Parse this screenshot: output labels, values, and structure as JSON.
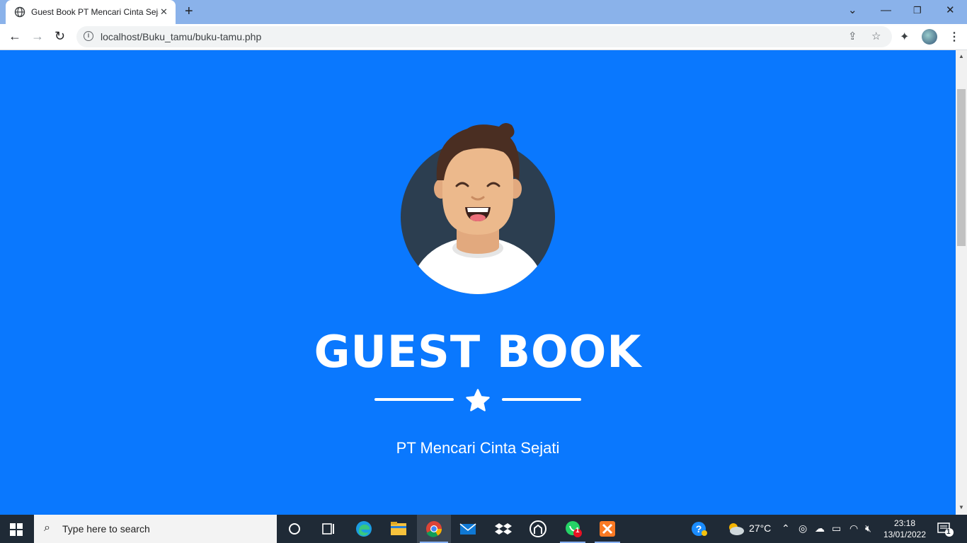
{
  "browser": {
    "tab_title": "Guest Book PT Mencari Cinta Sejati",
    "url": "localhost/Buku_tamu/buku-tamu.php"
  },
  "page": {
    "title": "GUEST BOOK",
    "subtitle": "PT Mencari Cinta Sejati"
  },
  "taskbar": {
    "search_placeholder": "Type here to search",
    "weather": "27°C",
    "time": "23:18",
    "date": "13/01/2022",
    "whatsapp_badge": "1",
    "notification_count": "1"
  },
  "colors": {
    "page_background": "#0a78fe",
    "tabstrip": "#8ab2ea",
    "avatar_circle": "#2c3e50"
  }
}
